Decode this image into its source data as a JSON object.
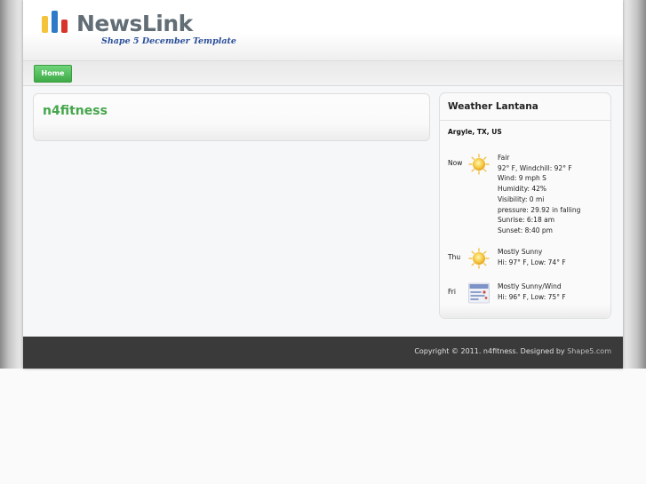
{
  "header": {
    "logo_name": "NewsLink",
    "tagline": "Shape 5 December Template",
    "logo_bar_colors": [
      "#f5c33b",
      "#2f79c9",
      "#d9332b"
    ]
  },
  "nav": {
    "home_label": "Home"
  },
  "article": {
    "title": "n4fitness"
  },
  "weather": {
    "title": "Weather Lantana",
    "location": "Argyle, TX, US",
    "now": {
      "day": "Now",
      "icon": "sun-icon",
      "lines": [
        "Fair",
        "92° F, Windchill: 92° F",
        "Wind: 9 mph S",
        "Humidity: 42%",
        "Visibility: 0 mi",
        "pressure: 29.92 in falling",
        "Sunrise: 6:18 am",
        "Sunset: 8:40 pm"
      ]
    },
    "forecast": [
      {
        "day": "Thu",
        "icon": "sun-icon",
        "condition": "Mostly Sunny",
        "temps": "Hi: 97° F, Low: 74° F"
      },
      {
        "day": "Fri",
        "icon": "wind-icon",
        "condition": "Mostly Sunny/Wind",
        "temps": "Hi: 96° F, Low: 75° F"
      }
    ]
  },
  "footer": {
    "copyright": "Copyright © 2011. n4fitness. Designed by",
    "link": "Shape5.com"
  },
  "colors": {
    "accent_green": "#45a64c",
    "nav_button": "#4cb955",
    "footer_bg": "#3a3a3a",
    "tagline": "#2a4f9a"
  }
}
